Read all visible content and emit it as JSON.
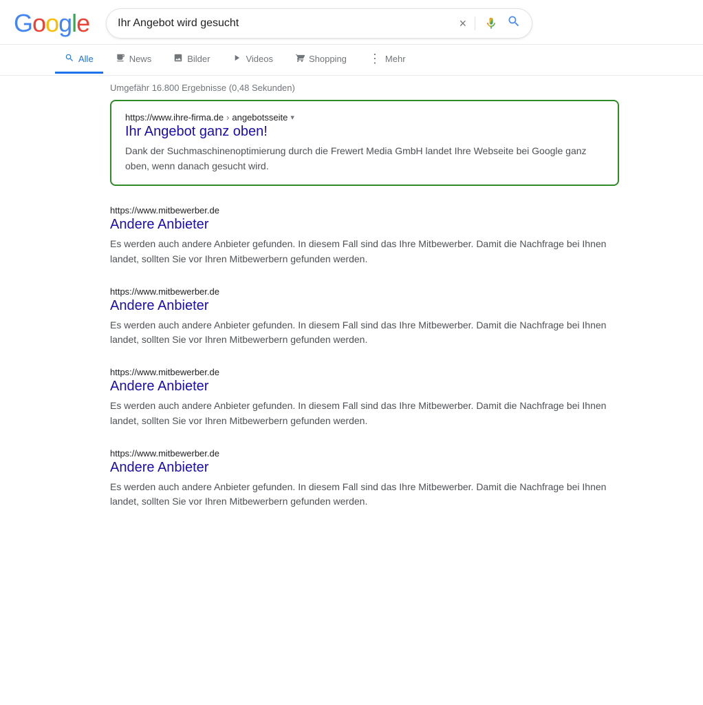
{
  "header": {
    "logo": {
      "g": "G",
      "o1": "o",
      "o2": "o",
      "g2": "g",
      "l": "l",
      "e": "e"
    },
    "search": {
      "value": "Ihr Angebot wird gesucht",
      "clear_label": "×",
      "mic_label": "Spracheingabe",
      "search_label": "Suche"
    }
  },
  "nav": {
    "tabs": [
      {
        "id": "alle",
        "label": "Alle",
        "icon": "🔍",
        "active": true
      },
      {
        "id": "news",
        "label": "News",
        "icon": "📰",
        "active": false
      },
      {
        "id": "bilder",
        "label": "Bilder",
        "icon": "🖼",
        "active": false
      },
      {
        "id": "videos",
        "label": "Videos",
        "icon": "▶",
        "active": false
      },
      {
        "id": "shopping",
        "label": "Shopping",
        "icon": "🏷",
        "active": false
      },
      {
        "id": "mehr",
        "label": "Mehr",
        "icon": "⋮",
        "active": false
      }
    ]
  },
  "results": {
    "info": "Umgefähr 16.800 Ergebnisse (0,48 Sekunden)",
    "featured": {
      "url_domain": "https://www.ihre-firma.de",
      "url_path": "angebotsseite",
      "title": "Ihr Angebot ganz oben!",
      "description": "Dank der Suchmaschinenoptimierung durch die Frewert Media GmbH landet Ihre Webseite bei Google ganz oben, wenn danach gesucht wird."
    },
    "regular": [
      {
        "url": "https://www.mitbewerber.de",
        "title": "Andere Anbieter",
        "description": "Es werden auch andere Anbieter gefunden. In diesem Fall sind das Ihre Mitbewerber. Damit die Nachfrage bei Ihnen landet, sollten Sie vor Ihren Mitbewerbern gefunden werden."
      },
      {
        "url": "https://www.mitbewerber.de",
        "title": "Andere Anbieter",
        "description": "Es werden auch andere Anbieter gefunden. In diesem Fall sind das Ihre Mitbewerber. Damit die Nachfrage bei Ihnen landet, sollten Sie vor Ihren Mitbewerbern gefunden werden."
      },
      {
        "url": "https://www.mitbewerber.de",
        "title": "Andere Anbieter",
        "description": "Es werden auch andere Anbieter gefunden. In diesem Fall sind das Ihre Mitbewerber. Damit die Nachfrage bei Ihnen landet, sollten Sie vor Ihren Mitbewerbern gefunden werden."
      },
      {
        "url": "https://www.mitbewerber.de",
        "title": "Andere Anbieter",
        "description": "Es werden auch andere Anbieter gefunden. In diesem Fall sind das Ihre Mitbewerber. Damit die Nachfrage bei Ihnen landet, sollten Sie vor Ihren Mitbewerbern gefunden werden."
      }
    ]
  },
  "colors": {
    "featured_border": "#2d8c27",
    "title_link": "#1a0dab",
    "url_text": "#202124",
    "description": "#4d5156",
    "nav_active": "#1a73e8",
    "muted": "#70757a"
  }
}
